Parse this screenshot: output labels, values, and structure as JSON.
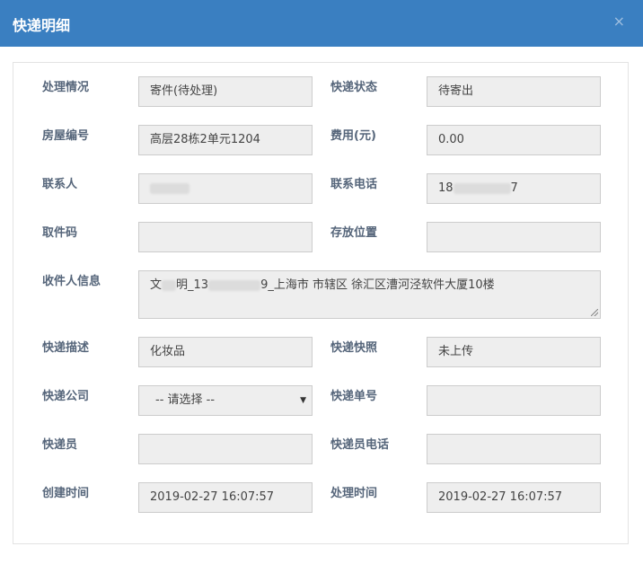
{
  "dialog": {
    "title": "快递明细",
    "close_icon": "×"
  },
  "form": {
    "status_label": "处理情况",
    "status_value": "寄件(待处理)",
    "delivery_status_label": "快递状态",
    "delivery_status_value": "待寄出",
    "room_label": "房屋编号",
    "room_value": "高层28栋2单元1204",
    "fee_label": "费用(元)",
    "fee_value": "0.00",
    "contact_label": "联系人",
    "contact_phone_label": "联系电话",
    "contact_phone_prefix": "18",
    "contact_phone_suffix": "7",
    "pickup_code_label": "取件码",
    "pickup_code_value": "",
    "storage_label": "存放位置",
    "storage_value": "",
    "recipient_label": "收件人信息",
    "recipient_prefix": "文",
    "recipient_mid1": "明_13",
    "recipient_mid2": "9_上海市 市辖区 徐汇区漕河泾软件大厦10楼",
    "desc_label": "快递描述",
    "desc_value": "化妆品",
    "photo_label": "快递快照",
    "photo_value": "未上传",
    "company_label": "快递公司",
    "company_selected": "-- 请选择 --",
    "tracking_label": "快递单号",
    "tracking_value": "",
    "courier_label": "快递员",
    "courier_value": "",
    "courier_phone_label": "快递员电话",
    "courier_phone_value": "",
    "created_label": "创建时间",
    "created_value": "2019-02-27 16:07:57",
    "processed_label": "处理时间",
    "processed_value": "2019-02-27 16:07:57"
  }
}
